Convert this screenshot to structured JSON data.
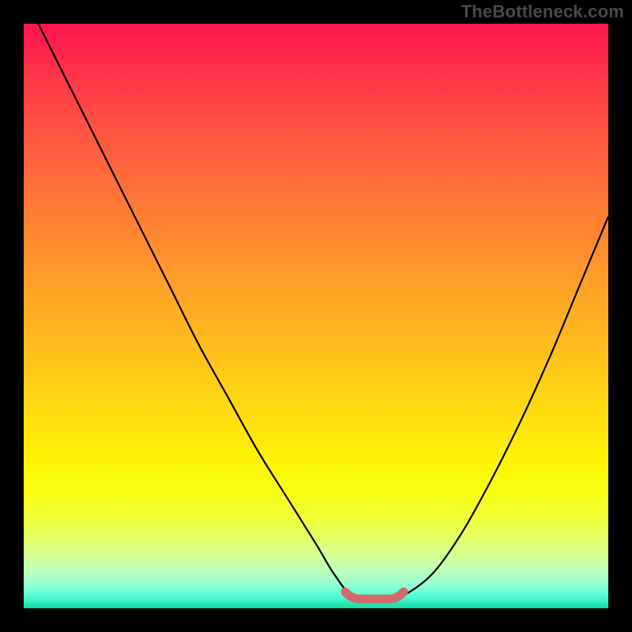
{
  "watermark": "TheBottleneck.com",
  "colors": {
    "frame": "#000000",
    "curve": "#000000",
    "best_zone": "#d26a6a",
    "watermark": "#4a4a4a"
  },
  "chart_data": {
    "type": "line",
    "title": "",
    "xlabel": "",
    "ylabel": "",
    "xlim": [
      0,
      100
    ],
    "ylim": [
      0,
      100
    ],
    "series": [
      {
        "name": "bottleneck-curve",
        "x": [
          0,
          5,
          10,
          15,
          20,
          25,
          30,
          35,
          40,
          45,
          50,
          53,
          56,
          59,
          62,
          65,
          70,
          75,
          80,
          85,
          90,
          95,
          100
        ],
        "y": [
          105,
          95,
          85,
          75,
          65,
          55,
          45,
          36,
          27,
          19,
          11,
          6,
          2.2,
          1.5,
          1.5,
          2.2,
          6,
          13,
          22,
          32,
          43,
          55,
          67
        ]
      }
    ],
    "best_zone": {
      "x_start": 55,
      "x_end": 65,
      "y": 1.6
    },
    "gradient_stops": [
      {
        "pos": 0,
        "color": "#ff1450"
      },
      {
        "pos": 0.5,
        "color": "#ffca17"
      },
      {
        "pos": 0.8,
        "color": "#f8ff10"
      },
      {
        "pos": 1.0,
        "color": "#14d99a"
      }
    ]
  }
}
